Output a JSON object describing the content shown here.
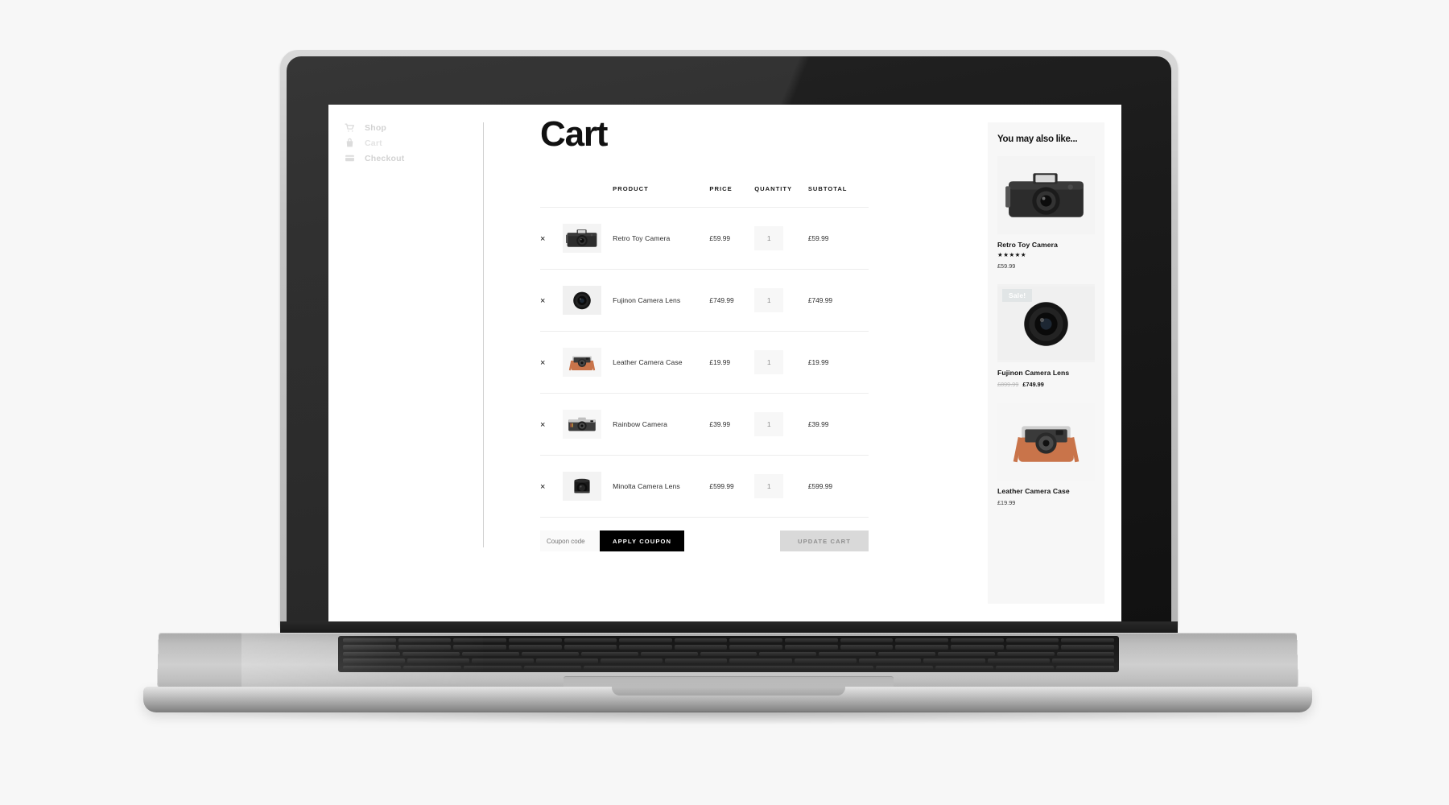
{
  "nav": {
    "items": [
      {
        "label": "Shop",
        "icon": "cart-icon",
        "current": false
      },
      {
        "label": "Cart",
        "icon": "bag-icon",
        "current": true
      },
      {
        "label": "Checkout",
        "icon": "credit-card-icon",
        "current": false
      }
    ]
  },
  "page": {
    "title": "Cart"
  },
  "table": {
    "headers": {
      "remove": "",
      "thumb": "",
      "product": "PRODUCT",
      "price": "PRICE",
      "quantity": "QUANTITY",
      "subtotal": "SUBTOTAL"
    },
    "remove_label": "×",
    "rows": [
      {
        "name": "Retro Toy Camera",
        "price": "£59.99",
        "qty": "1",
        "subtotal": "£59.99"
      },
      {
        "name": "Fujinon Camera Lens",
        "price": "£749.99",
        "qty": "1",
        "subtotal": "£749.99"
      },
      {
        "name": "Leather Camera Case",
        "price": "£19.99",
        "qty": "1",
        "subtotal": "£19.99"
      },
      {
        "name": "Rainbow Camera",
        "price": "£39.99",
        "qty": "1",
        "subtotal": "£39.99"
      },
      {
        "name": "Minolta Camera Lens",
        "price": "£599.99",
        "qty": "1",
        "subtotal": "£599.99"
      }
    ]
  },
  "actions": {
    "coupon_placeholder": "Coupon code",
    "coupon_value": "",
    "apply_label": "APPLY COUPON",
    "update_label": "UPDATE CART"
  },
  "upsell": {
    "title": "You may also like...",
    "items": [
      {
        "name": "Retro Toy Camera",
        "stars": "★★★★★",
        "price": "£59.99",
        "old_price": "",
        "badge": ""
      },
      {
        "name": "Fujinon Camera Lens",
        "stars": "",
        "price": "£749.99",
        "old_price": "£899.99",
        "badge": "Sale!"
      },
      {
        "name": "Leather Camera Case",
        "stars": "",
        "price": "£19.99",
        "old_price": "",
        "badge": ""
      }
    ]
  },
  "colors": {
    "accent": "#000000",
    "page_bg": "#f7f7f7",
    "muted": "#8e8e8e",
    "badge": "#e1e5e6"
  }
}
